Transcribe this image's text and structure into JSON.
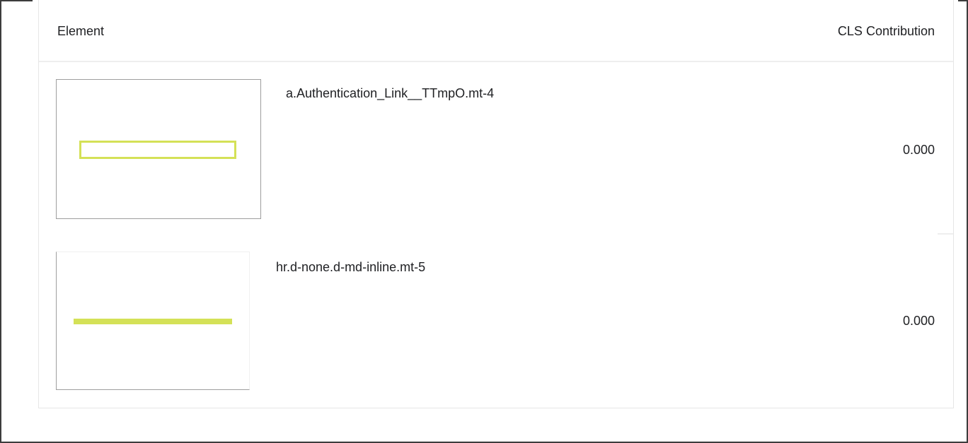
{
  "table": {
    "headers": {
      "element": "Element",
      "cls_contribution": "CLS Contribution"
    },
    "rows": [
      {
        "selector": "a.Authentication_Link__TTmpO.mt-4",
        "cls": "0.000",
        "highlight_shape": "outlined-rectangle",
        "highlight_color": "#d4e157"
      },
      {
        "selector": "hr.d-none.d-md-inline.mt-5",
        "cls": "0.000",
        "highlight_shape": "filled-bar",
        "highlight_color": "#d4e157"
      }
    ]
  }
}
